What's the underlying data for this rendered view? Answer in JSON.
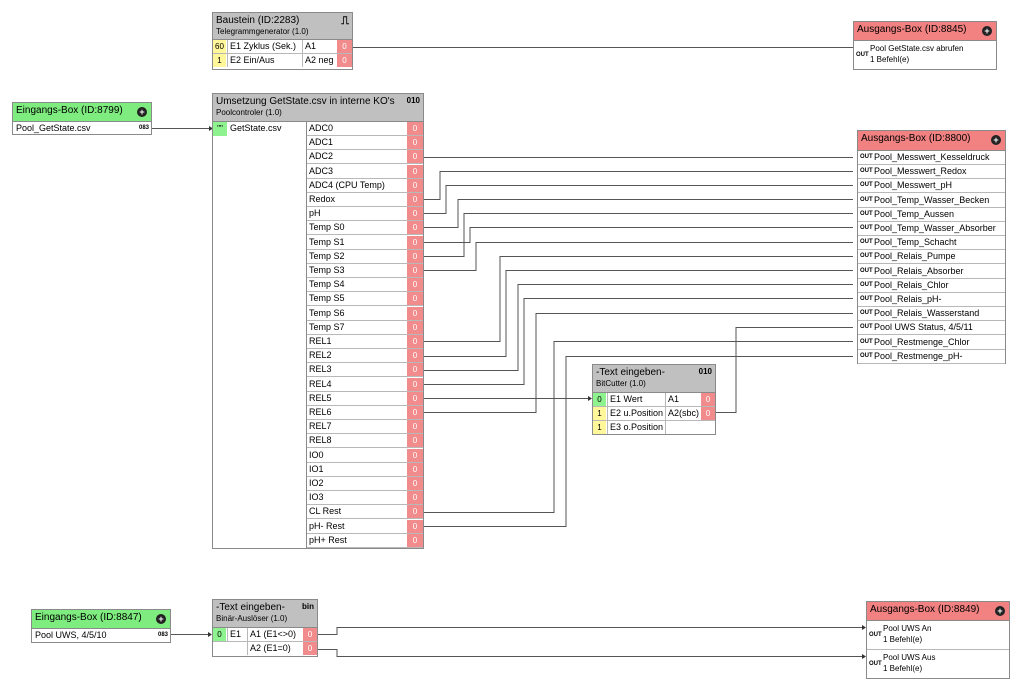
{
  "baustein": {
    "title": "Baustein (ID:2283)",
    "subtitle": "Telegrammgenerator (1.0)",
    "symbol": "⎍",
    "inputs": [
      {
        "value": "60",
        "label": "E1 Zyklus (Sek.)"
      },
      {
        "value": "1",
        "label": "E2 Ein/Aus"
      }
    ],
    "outputs": [
      {
        "label": "A1",
        "value": "0"
      },
      {
        "label": "A2 neg",
        "value": "0"
      }
    ]
  },
  "ausgang_8845": {
    "title": "Ausgangs-Box (ID:8845)",
    "items": [
      {
        "tag": "OUT",
        "line1": "Pool GetState.csv abrufen",
        "line2": "1 Befehl(e)"
      }
    ]
  },
  "eingang_8799": {
    "title": "Eingangs-Box (ID:8799)",
    "item": "Pool_GetState.csv",
    "tag": "083"
  },
  "umsetzung": {
    "title": "Umsetzung GetState.csv in interne KO's",
    "subtitle": "Poolcontroler (1.0)",
    "symbol": "010",
    "input_value": "\"\"",
    "input_label": "GetState.csv",
    "outputs": [
      "ADC0",
      "ADC1",
      "ADC2",
      "ADC3",
      "ADC4 (CPU Temp)",
      "Redox",
      "pH",
      "Temp S0",
      "Temp S1",
      "Temp S2",
      "Temp S3",
      "Temp S4",
      "Temp S5",
      "Temp S6",
      "Temp S7",
      "REL1",
      "REL2",
      "REL3",
      "REL4",
      "REL5",
      "REL6",
      "REL7",
      "REL8",
      "IO0",
      "IO1",
      "IO2",
      "IO3",
      "CL Rest",
      "pH- Rest",
      "pH+ Rest"
    ],
    "output_value": "0"
  },
  "ausgang_8800": {
    "title": "Ausgangs-Box (ID:8800)",
    "tag": "OUT",
    "items": [
      "Pool_Messwert_Kesseldruck",
      "Pool_Messwert_Redox",
      "Pool_Messwert_pH",
      "Pool_Temp_Wasser_Becken",
      "Pool_Temp_Aussen",
      "Pool_Temp_Wasser_Absorber",
      "Pool_Temp_Schacht",
      "Pool_Relais_Pumpe",
      "Pool_Relais_Absorber",
      "Pool_Relais_Chlor",
      "Pool_Relais_pH-",
      "Pool_Relais_Wasserstand",
      "Pool UWS Status, 4/5/11",
      "Pool_Restmenge_Chlor",
      "Pool_Restmenge_pH-"
    ]
  },
  "bitcutter": {
    "title": "-Text eingeben-",
    "subtitle": "BitCutter (1.0)",
    "symbol": "010",
    "inputs": [
      {
        "value": "0",
        "label": "E1 Wert"
      },
      {
        "value": "1",
        "label": "E2 u.Position"
      },
      {
        "value": "1",
        "label": "E3 o.Position"
      }
    ],
    "outputs": [
      {
        "label": "A1",
        "value": "0"
      },
      {
        "label": "A2(sbc)",
        "value": "0"
      }
    ]
  },
  "eingang_8847": {
    "title": "Eingangs-Box (ID:8847)",
    "item": "Pool UWS, 4/5/10",
    "tag": "083"
  },
  "binaer": {
    "title": "-Text eingeben-",
    "subtitle": "Binär-Auslöser (1.0)",
    "symbol": "bin",
    "input": {
      "value": "0",
      "label": "E1"
    },
    "outputs": [
      {
        "label": "A1 (E1<>0)",
        "value": "0"
      },
      {
        "label": "A2 (E1=0)",
        "value": "0"
      }
    ]
  },
  "ausgang_8849": {
    "title": "Ausgangs-Box (ID:8849)",
    "items": [
      {
        "tag": "OUT",
        "line1": "Pool UWS An",
        "line2": "1 Befehl(e)"
      },
      {
        "tag": "OUT",
        "line1": "Pool UWS Aus",
        "line2": "1 Befehl(e)"
      }
    ]
  },
  "colors": {
    "header_gray": "#c0c0c0",
    "header_green": "#7fec7f",
    "header_red": "#f28282",
    "value_yellow": "#fff79a",
    "value_green": "#8ef28e",
    "value_red": "#f28c8c"
  }
}
